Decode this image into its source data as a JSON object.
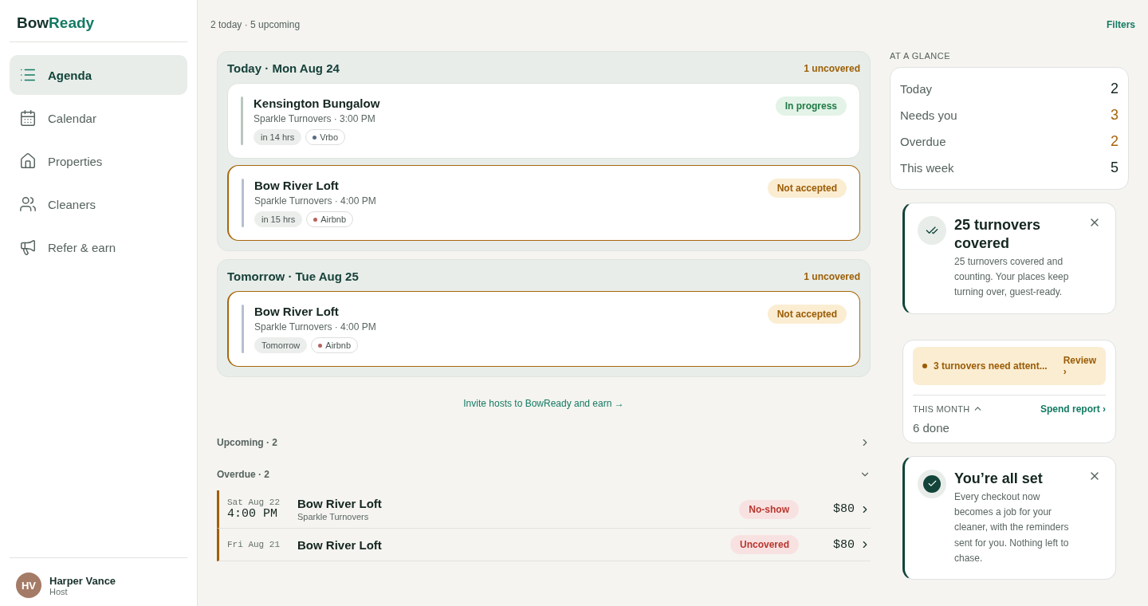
{
  "brand": {
    "first": "Bow",
    "second": "Ready"
  },
  "nav": [
    {
      "label": "Agenda",
      "kind": "list",
      "selected": true
    },
    {
      "label": "Calendar",
      "kind": "calendar",
      "selected": false
    },
    {
      "label": "Properties",
      "kind": "home",
      "selected": false
    },
    {
      "label": "Cleaners",
      "kind": "people",
      "selected": false
    },
    {
      "label": "Refer & earn",
      "kind": "megaphone",
      "selected": false
    }
  ],
  "user": {
    "initials": "HV",
    "name": "Harper Vance",
    "role": "Host"
  },
  "topbar": {
    "summary": "2 today · 5 upcoming",
    "filters": "Filters"
  },
  "days": [
    {
      "title": "Today · Mon Aug 24",
      "uncovered": "1 uncovered",
      "jobs": [
        {
          "property": "Kensington Bungalow",
          "detail": "Sparkle Turnovers · 3:00 PM",
          "status": "In progress",
          "kind": "in_progress",
          "tags": [
            {
              "label": "in 14 hrs",
              "kind": "time"
            },
            {
              "label": "Vrbo",
              "kind": "source",
              "color": "#5b6b86"
            }
          ]
        },
        {
          "property": "Bow River Loft",
          "detail": "Sparkle Turnovers · 4:00 PM",
          "status": "Not accepted",
          "kind": "not_accepted",
          "tags": [
            {
              "label": "in 15 hrs",
              "kind": "time"
            },
            {
              "label": "Airbnb",
              "kind": "source",
              "color": "#b5635e"
            }
          ]
        }
      ]
    },
    {
      "title": "Tomorrow · Tue Aug 25",
      "uncovered": "1 uncovered",
      "jobs": [
        {
          "property": "Bow River Loft",
          "detail": "Sparkle Turnovers · 4:00 PM",
          "status": "Not accepted",
          "kind": "not_accepted",
          "tags": [
            {
              "label": "Tomorrow",
              "kind": "time"
            },
            {
              "label": "Airbnb",
              "kind": "source",
              "color": "#b5635e"
            }
          ]
        }
      ]
    }
  ],
  "invite": "Invite hosts to BowReady and earn →",
  "sections": [
    {
      "label": "Upcoming · 2",
      "expanded": false
    },
    {
      "label": "Overdue · 2",
      "expanded": true
    }
  ],
  "overdue": [
    {
      "date": "Sat Aug 22",
      "time": "4:00 PM",
      "property": "Bow River Loft",
      "cleaner": "Sparkle Turnovers",
      "status": "No-show",
      "price": "$80"
    },
    {
      "date": "Fri Aug 21",
      "property": "Bow River Loft",
      "status": "Uncovered",
      "price": "$80"
    }
  ],
  "glance": {
    "title": "AT A GLANCE",
    "rows": [
      {
        "label": "Today",
        "value": "2",
        "warn": false
      },
      {
        "label": "Needs you",
        "value": "3",
        "warn": true
      },
      {
        "label": "Overdue",
        "value": "2",
        "warn": true
      },
      {
        "label": "This week",
        "value": "5",
        "warn": false
      }
    ]
  },
  "notices": [
    {
      "kind": "double-check",
      "title": "25 turnovers covered",
      "body": "25 turnovers covered and counting. Your places keep turning over, guest-ready."
    }
  ],
  "attention": {
    "text": "3 turnovers need attent...",
    "action": "Review",
    "action_caret": "›",
    "month_label": "THIS MONTH",
    "month_expanded": true,
    "report": "Spend report ›",
    "done": "6 done"
  },
  "notices2": [
    {
      "kind": "check",
      "title": "You’re all set",
      "body": "Every checkout now becomes a job for your cleaner, with the reminders sent for you. Nothing left to chase."
    }
  ]
}
